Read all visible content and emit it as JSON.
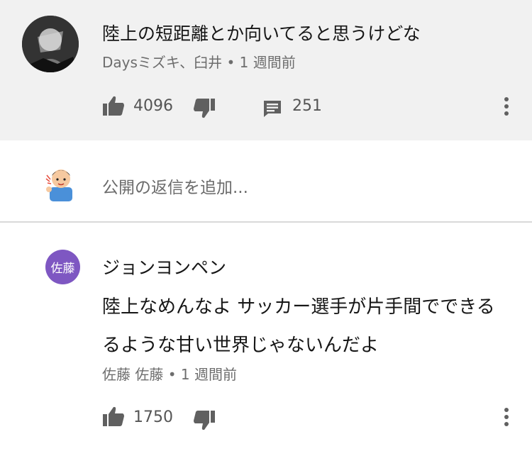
{
  "comment1": {
    "text": "陸上の短距離とか向いてると思うけどな",
    "meta": "Daysミズキ、臼井 • 1 週間前",
    "likes": "4096",
    "replies": "251"
  },
  "reply_box": {
    "placeholder": "公開の返信を追加..."
  },
  "comment2": {
    "avatar_initials": "佐藤",
    "author": "ジョンヨンペン",
    "body_line1": "陸上なめんなよ サッカー選手が片手間でできる",
    "body_line2": "るような甘い世界じゃないんだよ",
    "meta": "佐藤 佐藤 • 1 週間前",
    "likes": "1750"
  },
  "colors": {
    "top_bg": "#f1f1f1",
    "avatar_purple": "#7e57c2",
    "icon_gray": "#606060"
  },
  "icons": [
    "thumb-up-icon",
    "thumb-down-icon",
    "comment-icon",
    "more-vert-icon"
  ]
}
